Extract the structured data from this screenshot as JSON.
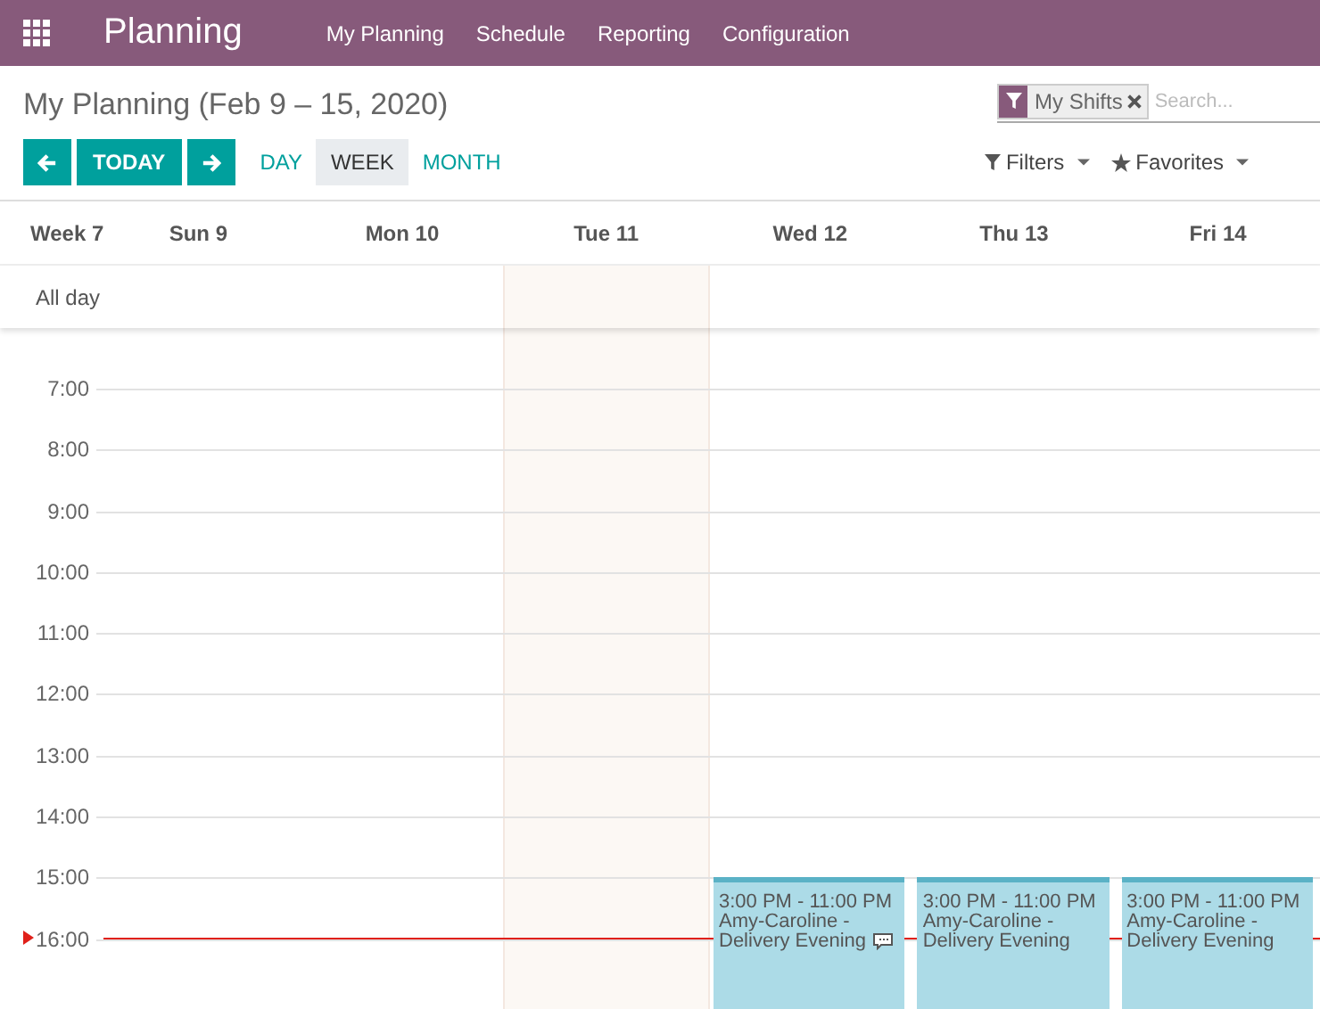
{
  "navbar": {
    "app_title": "Planning",
    "menu": [
      "My Planning",
      "Schedule",
      "Reporting",
      "Configuration"
    ]
  },
  "control_panel": {
    "title": "My Planning (Feb 9 – 15, 2020)",
    "facets": [
      {
        "label": "My Shifts"
      }
    ],
    "search": {
      "placeholder": "Search..."
    },
    "nav_buttons": [
      {
        "kind": "prev"
      },
      {
        "kind": "today",
        "label": "TODAY"
      },
      {
        "kind": "next"
      }
    ],
    "scales": [
      {
        "label": "DAY",
        "selected": false
      },
      {
        "label": "WEEK",
        "selected": true
      },
      {
        "label": "MONTH",
        "selected": false
      }
    ],
    "dropdowns": [
      {
        "kind": "filter",
        "label": "Filters"
      },
      {
        "kind": "favorite",
        "label": "Favorites"
      }
    ]
  },
  "calendar": {
    "week_label": "Week 7",
    "all_day_label": "All day",
    "days": [
      {
        "label": "Sun 9"
      },
      {
        "label": "Mon 10"
      },
      {
        "label": "Tue 11",
        "today": true
      },
      {
        "label": "Wed 12",
        "events": [
          {
            "time": "3:00 PM - 11:00 PM",
            "title": "Amy-Caroline - Delivery Evening",
            "has_message": true
          }
        ]
      },
      {
        "label": "Thu 13",
        "events": [
          {
            "time": "3:00 PM - 11:00 PM",
            "title": "Amy-Caroline - Delivery Evening",
            "has_message": false
          }
        ]
      },
      {
        "label": "Fri 14",
        "events": [
          {
            "time": "3:00 PM - 11:00 PM",
            "title": "Amy-Caroline - Delivery Evening",
            "has_message": false
          }
        ]
      }
    ],
    "hours": [
      {
        "label": "7:00",
        "now": false
      },
      {
        "label": "8:00",
        "now": false
      },
      {
        "label": "9:00",
        "now": false
      },
      {
        "label": "10:00",
        "now": false
      },
      {
        "label": "11:00",
        "now": false
      },
      {
        "label": "12:00",
        "now": false
      },
      {
        "label": "13:00",
        "now": false
      },
      {
        "label": "14:00",
        "now": false
      },
      {
        "label": "15:00",
        "now": false
      },
      {
        "label": "16:00",
        "now": true
      }
    ]
  }
}
